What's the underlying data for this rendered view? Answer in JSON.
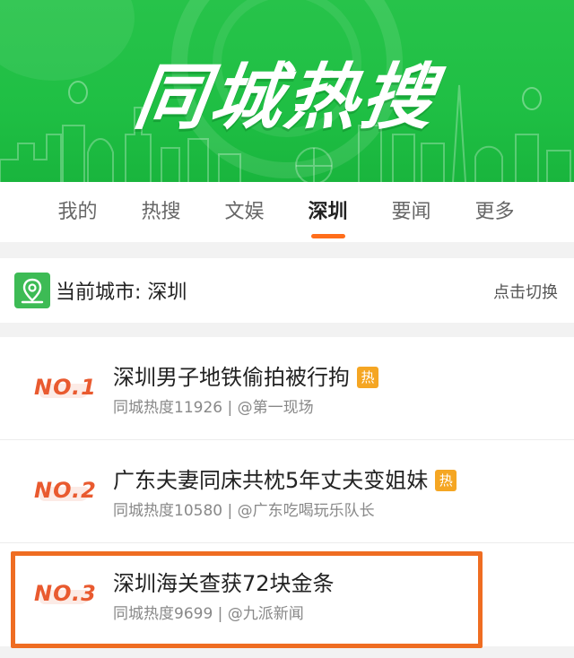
{
  "banner": {
    "title": "同城热搜"
  },
  "tabs": [
    {
      "label": "我的",
      "active": false
    },
    {
      "label": "热搜",
      "active": false
    },
    {
      "label": "文娱",
      "active": false
    },
    {
      "label": "深圳",
      "active": true
    },
    {
      "label": "要闻",
      "active": false
    },
    {
      "label": "更多",
      "active": false
    }
  ],
  "city": {
    "icon": "location-pin-icon",
    "label": "当前城市: 深圳",
    "switch_label": "点击切换"
  },
  "items": [
    {
      "rank": "NO.1",
      "rank_prefix": "NO",
      "rank_num": "1",
      "title": "深圳男子地铁偷拍被行拘",
      "hot": "热",
      "meta": "同城热度11926 | @第一现场"
    },
    {
      "rank": "NO.2",
      "rank_prefix": "NO",
      "rank_num": "2",
      "title": "广东夫妻同床共枕5年丈夫变姐妹",
      "hot": "热",
      "meta": "同城热度10580 | @广东吃喝玩乐队长"
    },
    {
      "rank": "NO.3",
      "rank_prefix": "NO",
      "rank_num": "3",
      "title": "深圳海关查获72块金条",
      "hot": "",
      "meta": "同城热度9699 | @九派新闻"
    }
  ],
  "colors": {
    "banner_green": "#27c34a",
    "accent_orange": "#ff6d1a",
    "rank_red": "#e95a2f",
    "hot_badge": "#f5a623",
    "highlight_border": "#ef6d22",
    "city_icon_green": "#3dbb55"
  }
}
